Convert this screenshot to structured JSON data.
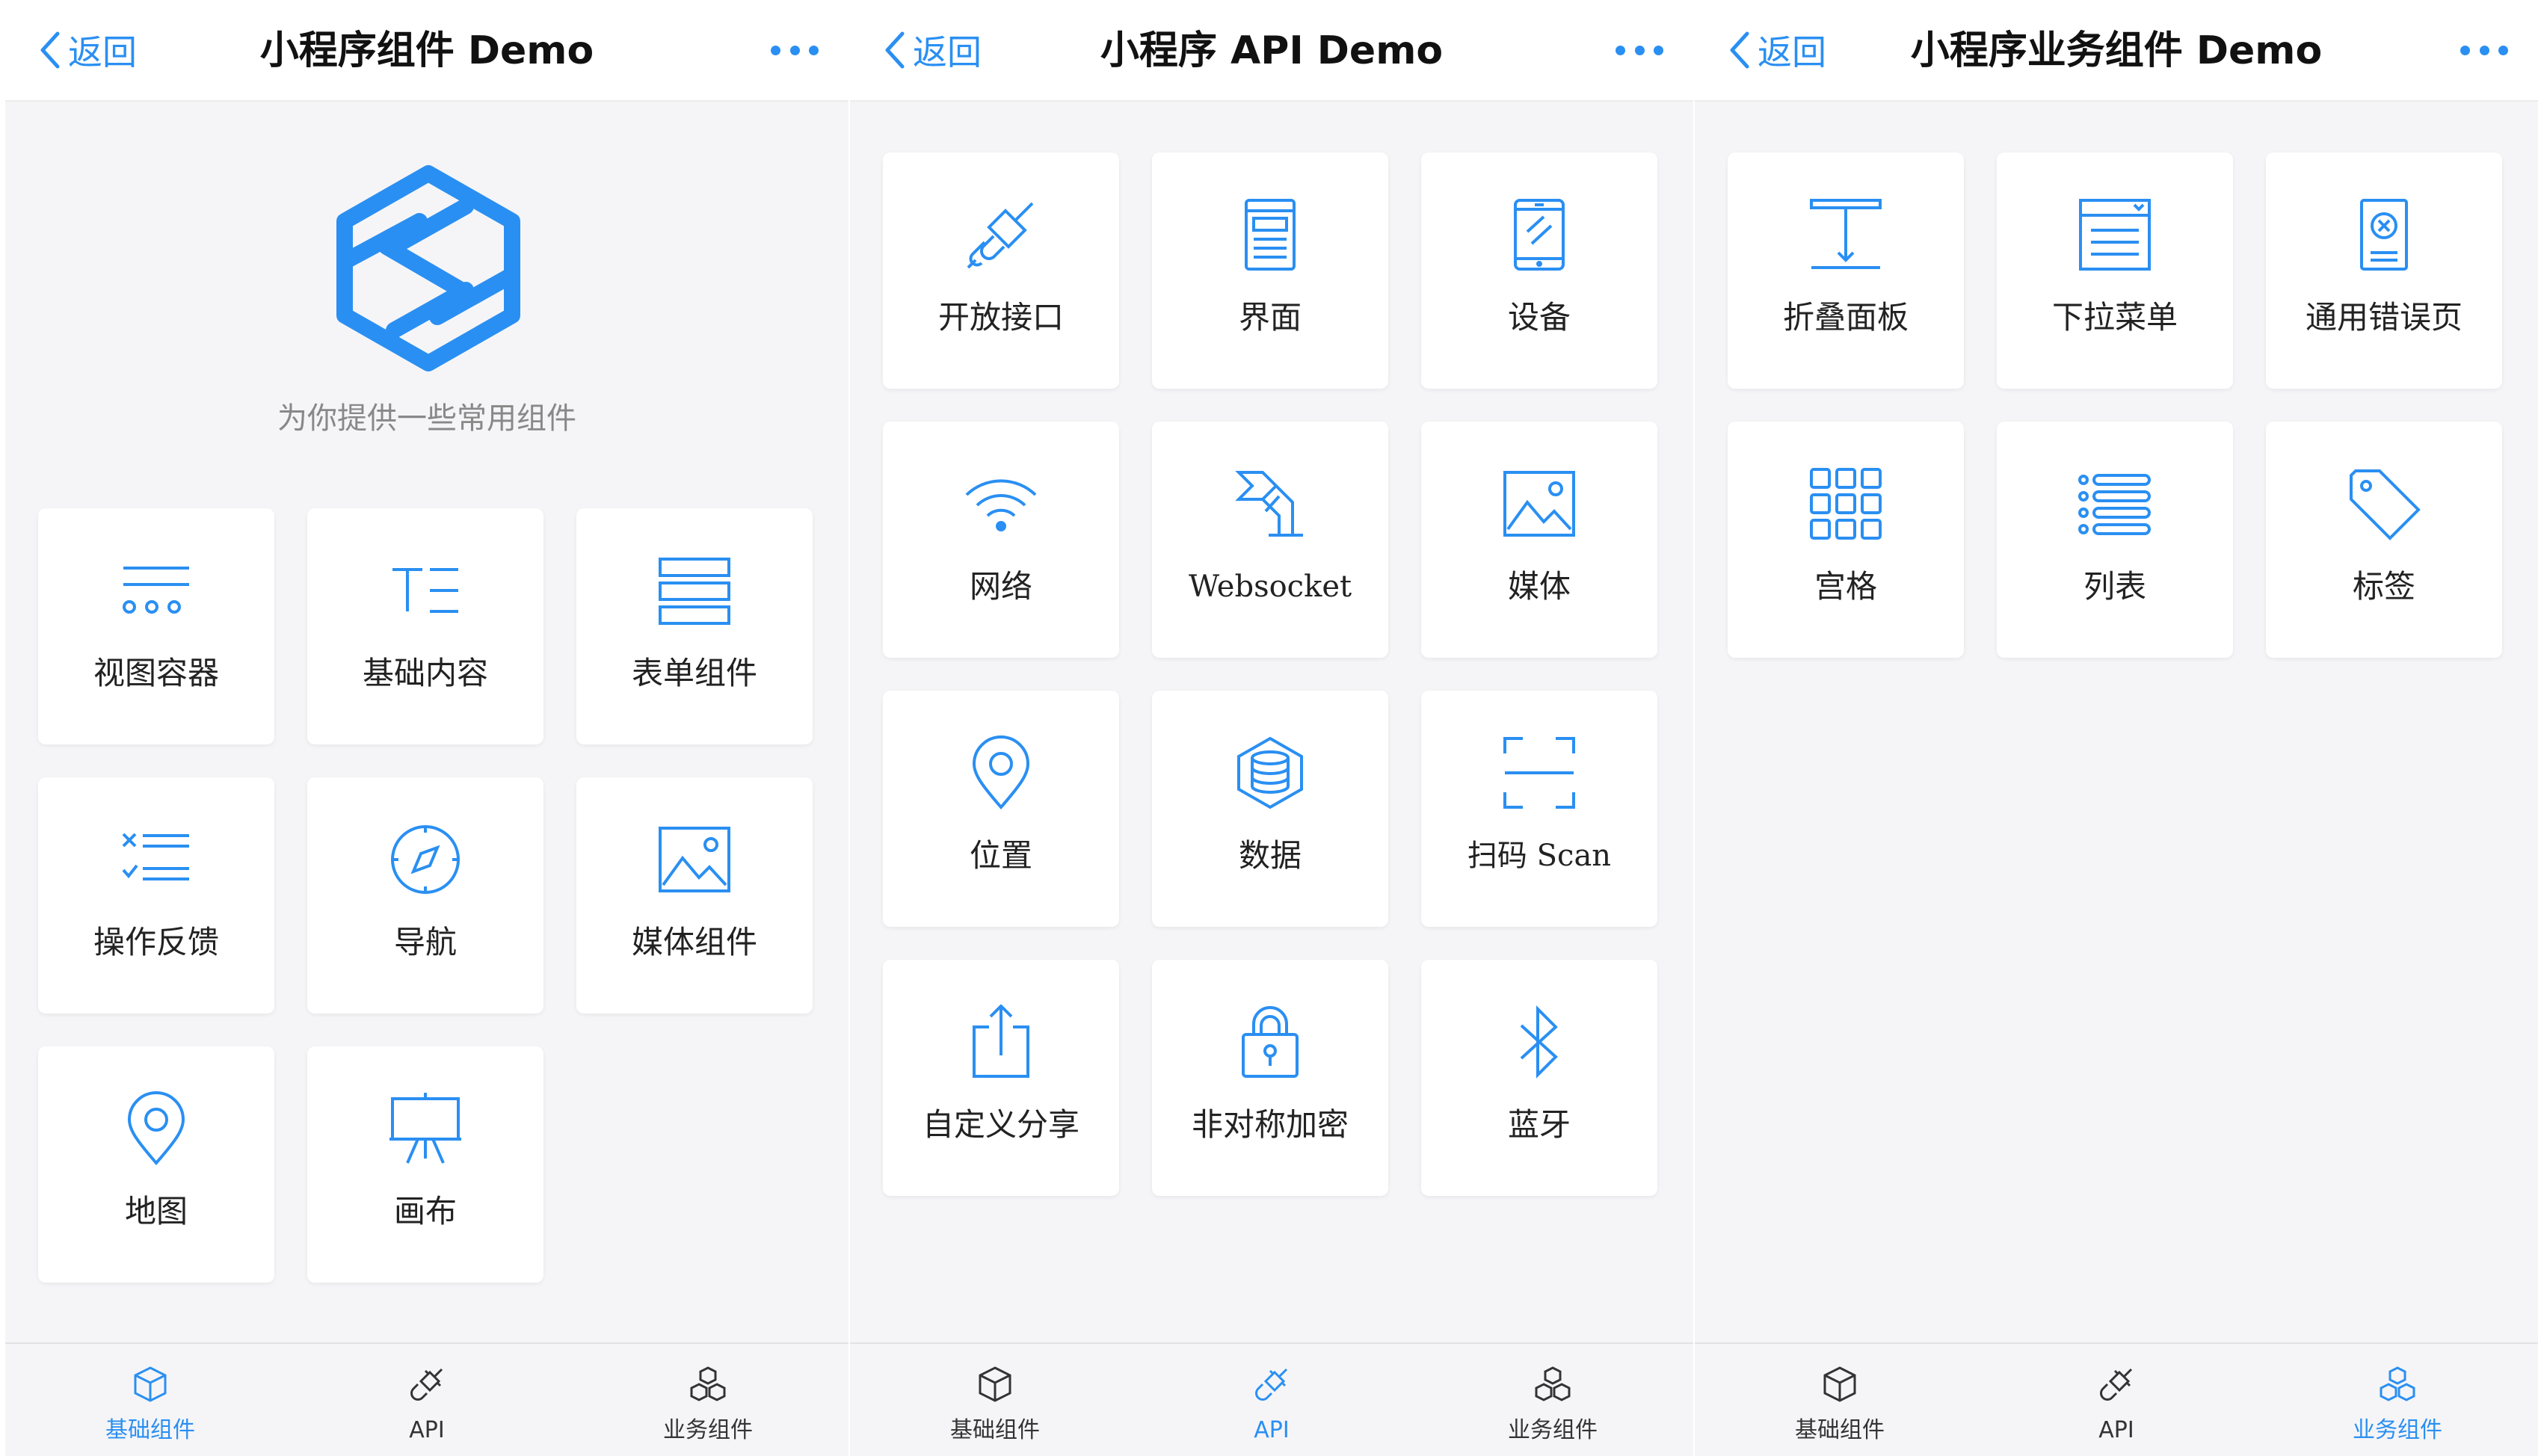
{
  "colors": {
    "accent": "#2a8ff2",
    "background": "#f5f5f7",
    "card": "#ffffff",
    "label": "#222222",
    "subtitle": "#888888"
  },
  "panels": [
    {
      "back_label": "返回",
      "title": "小程序组件 Demo",
      "subtitle": "为你提供一些常用组件",
      "items": [
        {
          "label": "视图容器",
          "icon": "view-container-icon"
        },
        {
          "label": "基础内容",
          "icon": "text-content-icon"
        },
        {
          "label": "表单组件",
          "icon": "form-icon"
        },
        {
          "label": "操作反馈",
          "icon": "feedback-icon"
        },
        {
          "label": "导航",
          "icon": "compass-icon"
        },
        {
          "label": "媒体组件",
          "icon": "image-icon"
        },
        {
          "label": "地图",
          "icon": "map-pin-icon"
        },
        {
          "label": "画布",
          "icon": "easel-icon"
        }
      ],
      "tabs": [
        {
          "label": "基础组件",
          "icon": "cube-icon",
          "active": true
        },
        {
          "label": "API",
          "icon": "plug-icon",
          "active": false
        },
        {
          "label": "业务组件",
          "icon": "cubes-icon",
          "active": false
        }
      ]
    },
    {
      "back_label": "返回",
      "title": "小程序 API Demo",
      "items": [
        {
          "label": "开放接口",
          "icon": "plug-icon"
        },
        {
          "label": "界面",
          "icon": "interface-icon"
        },
        {
          "label": "设备",
          "icon": "phone-icon"
        },
        {
          "label": "网络",
          "icon": "wifi-icon"
        },
        {
          "label": "Websocket",
          "icon": "websocket-icon"
        },
        {
          "label": "媒体",
          "icon": "image-icon"
        },
        {
          "label": "位置",
          "icon": "location-pin-icon"
        },
        {
          "label": "数据",
          "icon": "database-icon"
        },
        {
          "label": "扫码 Scan",
          "icon": "scan-icon"
        },
        {
          "label": "自定义分享",
          "icon": "share-icon"
        },
        {
          "label": "非对称加密",
          "icon": "lock-icon"
        },
        {
          "label": "蓝牙",
          "icon": "bluetooth-icon"
        }
      ],
      "tabs": [
        {
          "label": "基础组件",
          "icon": "cube-icon",
          "active": false
        },
        {
          "label": "API",
          "icon": "plug-icon",
          "active": true
        },
        {
          "label": "业务组件",
          "icon": "cubes-icon",
          "active": false
        }
      ]
    },
    {
      "back_label": "返回",
      "title": "小程序业务组件 Demo",
      "items": [
        {
          "label": "折叠面板",
          "icon": "collapse-icon"
        },
        {
          "label": "下拉菜单",
          "icon": "dropdown-menu-icon"
        },
        {
          "label": "通用错误页",
          "icon": "error-page-icon"
        },
        {
          "label": "宫格",
          "icon": "grid-icon"
        },
        {
          "label": "列表",
          "icon": "list-icon"
        },
        {
          "label": "标签",
          "icon": "tag-icon"
        }
      ],
      "tabs": [
        {
          "label": "基础组件",
          "icon": "cube-icon",
          "active": false
        },
        {
          "label": "API",
          "icon": "plug-icon",
          "active": false
        },
        {
          "label": "业务组件",
          "icon": "cubes-icon",
          "active": true
        }
      ]
    }
  ]
}
